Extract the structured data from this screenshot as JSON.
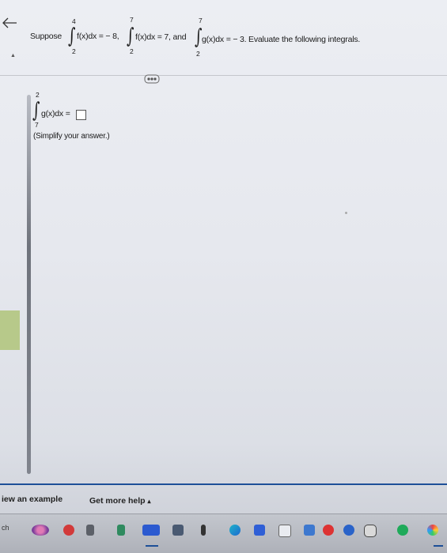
{
  "question": {
    "lead": "Suppose",
    "integral1": {
      "upper": "4",
      "lower": "2",
      "body": "f(x)dx = − 8,"
    },
    "integral2": {
      "upper": "7",
      "lower": "2",
      "body": "f(x)dx = 7, and"
    },
    "integral3": {
      "upper": "7",
      "lower": "2",
      "body": "g(x)dx = − 3. Evaluate the following integrals."
    }
  },
  "part": {
    "upper": "2",
    "lower": "7",
    "body": "g(x)dx =",
    "hint": "(Simplify your answer.)"
  },
  "bottom": {
    "view_example": "iew an example",
    "get_help": "Get more help",
    "get_help_arrow": "▴",
    "left_stub": "ch"
  },
  "colors": {
    "accent": "#1d4f98",
    "background": "#e9ebf0"
  },
  "icons": [
    "back-arrow-icon",
    "expand-icon",
    "taskbar-app-icons"
  ]
}
